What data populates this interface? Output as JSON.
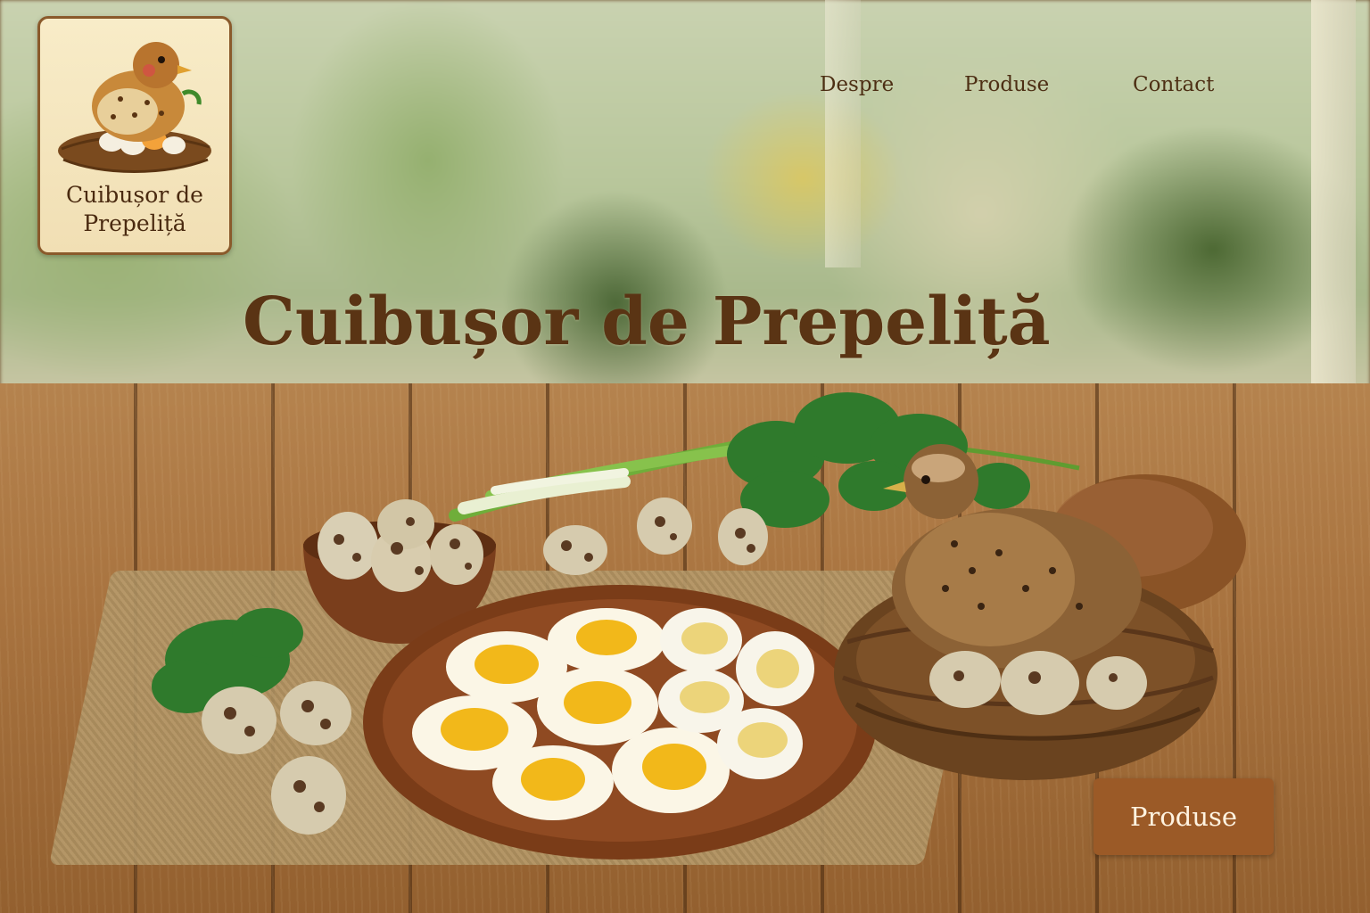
{
  "logo": {
    "line1": "Cuibușor de",
    "line2": "Prepeliță"
  },
  "nav": {
    "items": [
      {
        "label": "Despre"
      },
      {
        "label": "Produse"
      },
      {
        "label": "Contact"
      }
    ]
  },
  "hero": {
    "title": "Cuibușor de Prepeliță",
    "cta_label": "Produse"
  },
  "colors": {
    "brand_brown": "#5a3414",
    "cta_background": "#9b5a27",
    "cta_text": "#fff3e0",
    "logo_background": "#f8ecc8"
  },
  "icons": [
    "quail-nest-logo-icon"
  ]
}
